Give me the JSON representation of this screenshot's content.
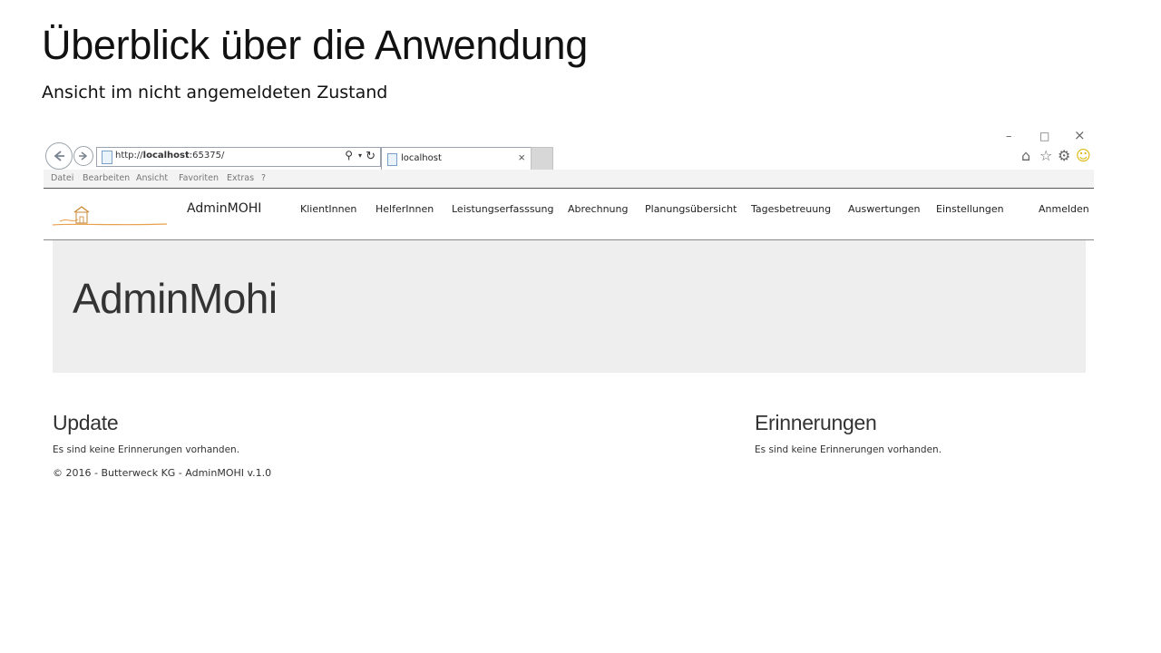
{
  "slide": {
    "title": "Überblick über die Anwendung",
    "subtitle": "Ansicht im nicht angemeldeten Zustand"
  },
  "window_controls": {
    "minimize": "–",
    "maximize": "□",
    "close": "×"
  },
  "browser": {
    "address_prefix": "http://",
    "address_host": "localhost",
    "address_suffix": ":65375/",
    "tab_title": "localhost",
    "tab_close": "×",
    "icons": [
      "back-icon",
      "forward-icon",
      "search-icon",
      "refresh-icon",
      "home-icon",
      "star-icon",
      "gear-icon",
      "smiley-icon"
    ],
    "menu": [
      "Datei",
      "Bearbeiten",
      "Ansicht",
      "Favoriten",
      "Extras",
      "?"
    ]
  },
  "navbar": {
    "brand": "AdminMOHI",
    "items": [
      "KlientInnen",
      "HelferInnen",
      "Leistungserfasssung",
      "Abrechnung",
      "Planungsübersicht",
      "Tagesbetreuung",
      "Auswertungen",
      "Einstellungen"
    ],
    "login": "Anmelden"
  },
  "jumbotron": {
    "title": "AdminMohi"
  },
  "sections": {
    "update": {
      "heading": "Update",
      "text": "Es sind keine Erinnerungen vorhanden."
    },
    "reminders": {
      "heading": "Erinnerungen",
      "text": "Es sind keine Erinnerungen vorhanden."
    }
  },
  "footer": "© 2016 - Butterweck KG - AdminMOHI v.1.0",
  "colors": {
    "jumbotron_bg": "#eeeeee",
    "logo_accent": "#e8a04a"
  }
}
